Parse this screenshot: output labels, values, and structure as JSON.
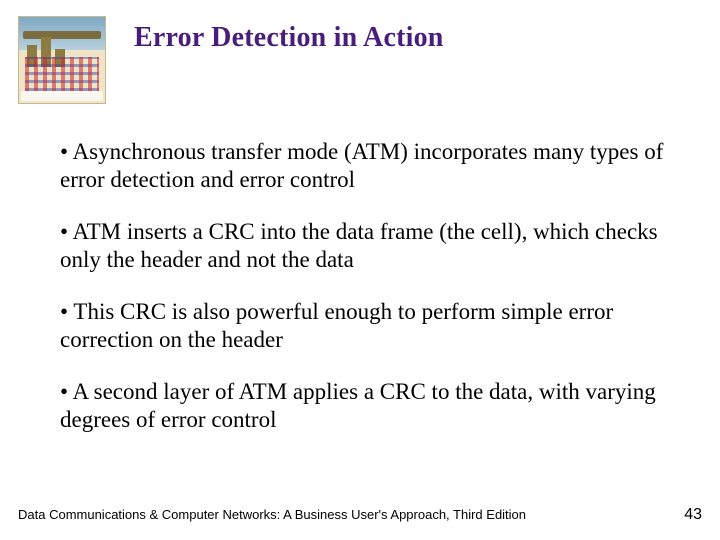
{
  "header": {
    "title": "Error Detection in Action"
  },
  "bullets": {
    "b1": "Asynchronous transfer mode (ATM) incorporates many types of error detection and error control",
    "b2": "ATM inserts a CRC into the data frame (the cell), which checks only the header and not the data",
    "b3": "This CRC is also powerful enough to perform simple error correction on the header",
    "b4": "A second layer of ATM applies a CRC to the data, with varying degrees of error control"
  },
  "footer": {
    "text": "Data Communications & Computer Networks: A Business User's Approach, Third Edition",
    "page": "43"
  }
}
